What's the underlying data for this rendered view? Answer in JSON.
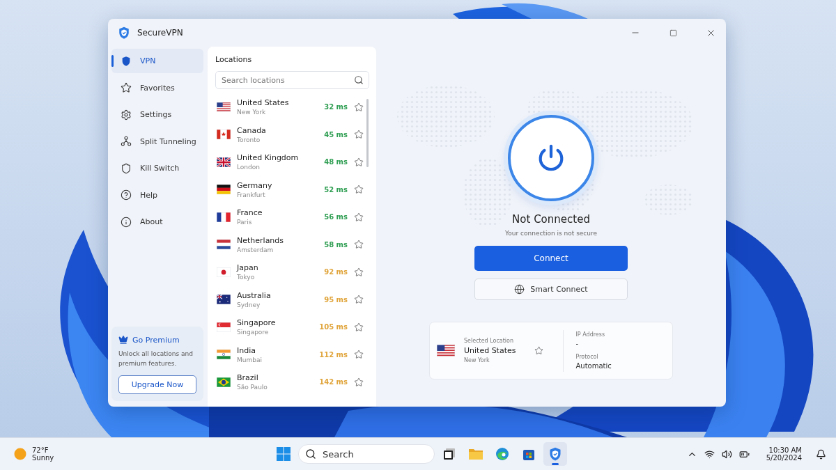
{
  "window": {
    "title": "SecureVPN"
  },
  "sidebar": {
    "items": [
      {
        "label": "VPN",
        "selected": true
      },
      {
        "label": "Favorites",
        "selected": false
      },
      {
        "label": "Settings",
        "selected": false
      },
      {
        "label": "Split Tunneling",
        "selected": false
      },
      {
        "label": "Kill Switch",
        "selected": false
      },
      {
        "label": "Help",
        "selected": false
      },
      {
        "label": "About",
        "selected": false
      }
    ],
    "premium": {
      "title": "Go Premium",
      "text": "Unlock all locations and premium features.",
      "button": "Upgrade Now"
    }
  },
  "locations": {
    "title": "Locations",
    "search": {
      "placeholder": "Search locations"
    },
    "items": [
      {
        "country": "United States",
        "city": "New York",
        "latency": "32 ms",
        "color": "#2f9e52"
      },
      {
        "country": "Canada",
        "city": "Toronto",
        "latency": "45 ms",
        "color": "#2f9e52"
      },
      {
        "country": "United Kingdom",
        "city": "London",
        "latency": "48 ms",
        "color": "#2f9e52"
      },
      {
        "country": "Germany",
        "city": "Frankfurt",
        "latency": "52 ms",
        "color": "#2f9e52"
      },
      {
        "country": "France",
        "city": "Paris",
        "latency": "56 ms",
        "color": "#2f9e52"
      },
      {
        "country": "Netherlands",
        "city": "Amsterdam",
        "latency": "58 ms",
        "color": "#2f9e52"
      },
      {
        "country": "Japan",
        "city": "Tokyo",
        "latency": "92 ms",
        "color": "#e0a43a"
      },
      {
        "country": "Australia",
        "city": "Sydney",
        "latency": "95 ms",
        "color": "#e0a43a"
      },
      {
        "country": "Singapore",
        "city": "Singapore",
        "latency": "105 ms",
        "color": "#e0a43a"
      },
      {
        "country": "India",
        "city": "Mumbai",
        "latency": "112 ms",
        "color": "#e0a43a"
      },
      {
        "country": "Brazil",
        "city": "São Paulo",
        "latency": "142 ms",
        "color": "#e0a43a"
      }
    ]
  },
  "status": {
    "title": "Not Connected",
    "subtitle": "Your connection is not secure",
    "connect_button": "Connect",
    "smart_button": "Smart Connect"
  },
  "info": {
    "selected_label": "Selected Location",
    "country": "United States",
    "city": "New York",
    "ip_label": "IP Address",
    "ip_value": "-",
    "protocol_label": "Protocol",
    "protocol_value": "Automatic"
  },
  "taskbar": {
    "weather": {
      "temp": "72°F",
      "condition": "Sunny"
    },
    "search": {
      "placeholder": "Search"
    },
    "apps": [
      {
        "selected": false
      },
      {
        "selected": false
      },
      {
        "selected": false
      },
      {
        "selected": false
      },
      {
        "selected": true
      }
    ],
    "time": "10:30 AM",
    "date": "5/20/2024"
  }
}
